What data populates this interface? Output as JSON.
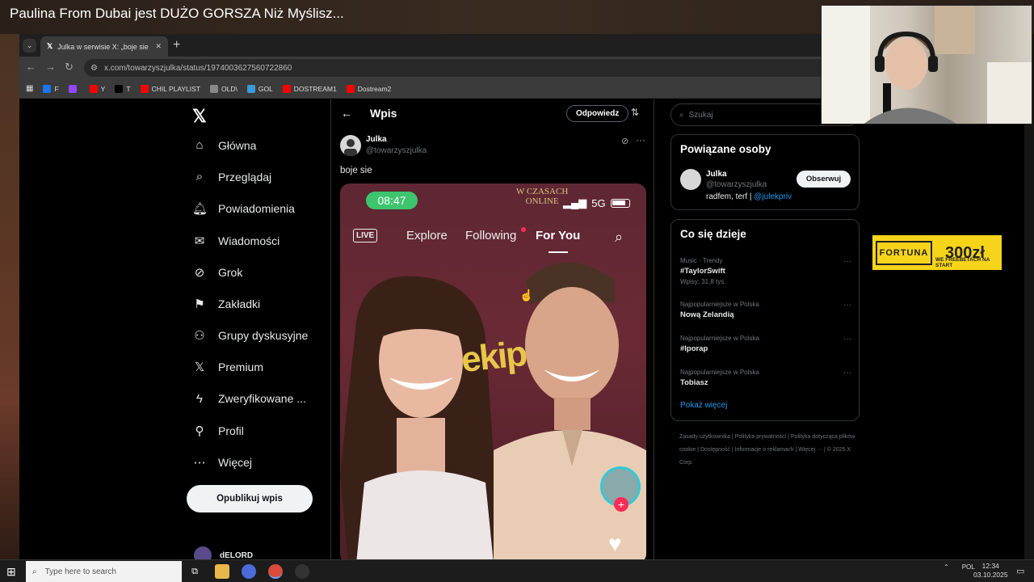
{
  "video_title": "Paulina From Dubai jest DUŻO GORSZA Niż Myślisz...",
  "browser": {
    "tab_title": "Julka w serwisie X: „boje sie htt",
    "new_tab_symbol": "+",
    "url": "x.com/towarzyszjulka/status/1974003627560722860",
    "bookmarks": [
      {
        "label": "F",
        "icon": "facebook-icon",
        "color": "#1877f2"
      },
      {
        "label": "",
        "icon": "twitch-icon",
        "color": "#9146ff"
      },
      {
        "label": "Y",
        "icon": "youtube-icon",
        "color": "#ff0000"
      },
      {
        "label": "T",
        "icon": "x-icon",
        "color": "#000000"
      },
      {
        "label": "CHIL PLAYLIST",
        "icon": "youtube-icon",
        "color": "#ff0000"
      },
      {
        "label": "OLD\\",
        "icon": "folder-icon",
        "color": "#888888"
      },
      {
        "label": "GOL",
        "icon": "gol-icon",
        "color": "#3a9ad9"
      },
      {
        "label": "DOSTREAM1",
        "icon": "youtube-icon",
        "color": "#ff0000"
      },
      {
        "label": "Dostream2",
        "icon": "youtube-icon",
        "color": "#ff0000"
      }
    ]
  },
  "nav": {
    "items": [
      {
        "label": "Główna",
        "icon": "home-icon"
      },
      {
        "label": "Przeglądaj",
        "icon": "search-icon"
      },
      {
        "label": "Powiadomienia",
        "icon": "bell-icon"
      },
      {
        "label": "Wiadomości",
        "icon": "mail-icon"
      },
      {
        "label": "Grok",
        "icon": "grok-icon"
      },
      {
        "label": "Zakładki",
        "icon": "bookmark-icon"
      },
      {
        "label": "Grupy dyskusyjne",
        "icon": "communities-icon"
      },
      {
        "label": "Premium",
        "icon": "x-icon"
      },
      {
        "label": "Zweryfikowane ...",
        "icon": "lightning-icon"
      },
      {
        "label": "Profil",
        "icon": "person-icon"
      },
      {
        "label": "Więcej",
        "icon": "more-circle-icon"
      }
    ],
    "post_button": "Opublikuj wpis",
    "user": "dELORD"
  },
  "post": {
    "header_title": "Wpis",
    "reply_button": "Odpowiedz",
    "author_name": "Julka",
    "author_handle": "@towarzyszjulka",
    "text": "boje sie",
    "video": {
      "time": "08:47",
      "network": "5G",
      "overlay_text": "W CZASACH\nONLINE",
      "tabs": [
        "LIVE",
        "Explore",
        "Following",
        "For You"
      ],
      "logo": "ekip"
    }
  },
  "sidebar": {
    "search_placeholder": "Szukaj",
    "related_title": "Powiązane osoby",
    "related_name": "Julka",
    "related_handle": "@towarzyszjulka",
    "related_bio": "radfem, terf |",
    "related_bio_link": "@julekpriv",
    "follow_button": "Obserwuj",
    "trends_title": "Co się dzieje",
    "trends": [
      {
        "category": "Music · Trendy",
        "name": "#TaylorSwift",
        "count": "Wpisy: 31,8 tys."
      },
      {
        "category": "Najpopularniejsze w Polska",
        "name": "Nową Zelandią",
        "count": ""
      },
      {
        "category": "Najpopularniejsze w Polska",
        "name": "#lporap",
        "count": ""
      },
      {
        "category": "Najpopularniejsze w Polska",
        "name": "Tobiasz",
        "count": ""
      }
    ],
    "show_more": "Pokaż więcej",
    "footer": [
      "Zasady użytkownika",
      "Polityka prywatności",
      "Polityka dotycząca plików cookie",
      "Dostępność",
      "Informacje o reklamach",
      "Więcej ···",
      "© 2025 X Corp."
    ]
  },
  "ad": {
    "brand": "FORTUNA",
    "amount": "300zł",
    "subtitle": "WE FREEBETACH NA START"
  },
  "taskbar": {
    "search_placeholder": "Type here to search",
    "lang": "POL",
    "time": "12:34",
    "date": "03.10.2025"
  }
}
